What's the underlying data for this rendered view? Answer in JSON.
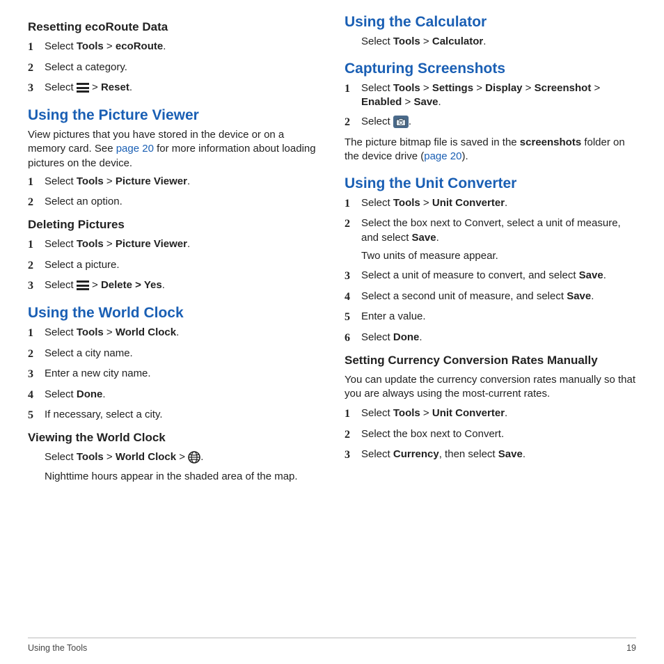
{
  "footer": {
    "left": "Using the Tools",
    "right": "19"
  },
  "left": {
    "resetEcoRoute": {
      "title": "Resetting ecoRoute Data",
      "step1": {
        "pre": "Select ",
        "b1": "Tools",
        "mid": " > ",
        "b2": "ecoRoute",
        "suf": "."
      },
      "step2": "Select a category.",
      "step3": {
        "pre": "Select ",
        "menu": true,
        "mid": " > ",
        "b1": "Reset",
        "suf": "."
      }
    },
    "pictureViewer": {
      "title": "Using the Picture Viewer",
      "intro1": "View pictures that you have stored in the device or on a memory card. See ",
      "introLink": "page 20",
      "intro2": " for more information about loading pictures on the device.",
      "step1": {
        "pre": "Select ",
        "b1": "Tools",
        "mid": " > ",
        "b2": "Picture Viewer",
        "suf": "."
      },
      "step2": "Select an option.",
      "deletingTitle": "Deleting Pictures",
      "del1": {
        "pre": "Select ",
        "b1": "Tools",
        "mid": " > ",
        "b2": "Picture Viewer",
        "suf": "."
      },
      "del2": "Select a picture.",
      "del3": {
        "pre": "Select ",
        "menu": true,
        "mid": " > ",
        "b1": "Delete > Yes",
        "suf": "."
      }
    },
    "worldClock": {
      "title": "Using the World Clock",
      "s1": {
        "pre": "Select ",
        "b1": "Tools",
        "mid": " > ",
        "b2": "World Clock",
        "suf": "."
      },
      "s2": "Select a city name.",
      "s3": "Enter a new city name.",
      "s4": {
        "pre": "Select ",
        "b1": "Done",
        "suf": "."
      },
      "s5": "If necessary, select a city.",
      "viewTitle": "Viewing the World Clock",
      "viewLine": {
        "pre": "Select ",
        "b1": "Tools",
        "mid1": " > ",
        "b2": "World Clock",
        "mid2": " > ",
        "globe": true,
        "suf": "."
      },
      "viewNote": "Nighttime hours appear in the shaded area of the map."
    }
  },
  "right": {
    "calculator": {
      "title": "Using the Calculator",
      "line": {
        "pre": "Select ",
        "b1": "Tools",
        "mid": " > ",
        "b2": "Calculator",
        "suf": "."
      }
    },
    "screenshots": {
      "title": "Capturing Screenshots",
      "s1": {
        "pre": "Select ",
        "b1": "Tools",
        "m1": " > ",
        "b2": "Settings",
        "m2": " > ",
        "b3": "Display",
        "m3": " > ",
        "b4": "Screenshot",
        "m4": " > ",
        "b5": "Enabled",
        "m5": " > ",
        "b6": "Save",
        "suf": "."
      },
      "s2": {
        "pre": "Select ",
        "camera": true,
        "suf": "."
      },
      "note1": "The picture bitmap file is saved in the ",
      "noteB": "screenshots",
      "note2": " folder on the device drive (",
      "noteLink": "page 20",
      "note3": ")."
    },
    "unitConverter": {
      "title": "Using the Unit Converter",
      "s1": {
        "pre": "Select ",
        "b1": "Tools",
        "mid": " > ",
        "b2": "Unit Converter",
        "suf": "."
      },
      "s2": {
        "pre": "Select the box next to Convert, select a unit of measure, and select ",
        "b1": "Save",
        "suf": "."
      },
      "s2note": "Two units of measure appear.",
      "s3": {
        "pre": "Select a unit of measure to convert, and select ",
        "b1": "Save",
        "suf": "."
      },
      "s4": {
        "pre": "Select a second unit of measure, and select ",
        "b1": "Save",
        "suf": "."
      },
      "s5": "Enter a value.",
      "s6": {
        "pre": "Select ",
        "b1": "Done",
        "suf": "."
      },
      "manualTitle": "Setting Currency Conversion Rates Manually",
      "manualIntro": "You can update the currency conversion rates manually so that you are always using the most-current rates.",
      "m1": {
        "pre": "Select ",
        "b1": "Tools",
        "mid": " > ",
        "b2": "Unit Converter",
        "suf": "."
      },
      "m2": "Select the box next to Convert.",
      "m3": {
        "pre": "Select ",
        "b1": "Currency",
        "mid": ", then select ",
        "b2": "Save",
        "suf": "."
      }
    }
  },
  "nums": {
    "1": "1",
    "2": "2",
    "3": "3",
    "4": "4",
    "5": "5",
    "6": "6"
  }
}
